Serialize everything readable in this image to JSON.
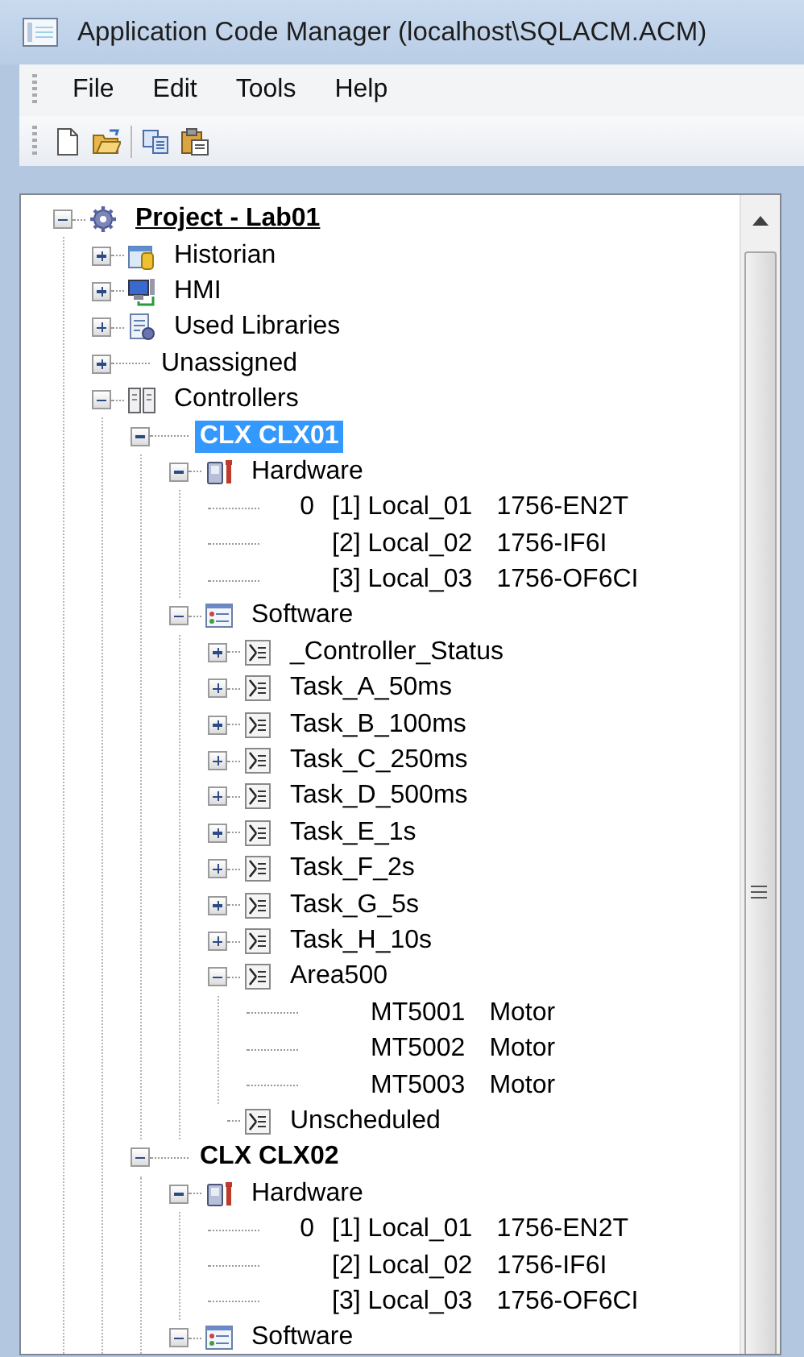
{
  "window": {
    "title": "Application Code Manager (localhost\\SQLACM.ACM)"
  },
  "menu": [
    "File",
    "Edit",
    "Tools",
    "Help"
  ],
  "tree": [
    {
      "label": "Project - Lab01",
      "kind": "project",
      "expanded": true,
      "selected": false,
      "children": [
        {
          "label": "Historian",
          "kind": "historian",
          "expanded": false,
          "selected": false
        },
        {
          "label": "HMI",
          "kind": "hmi",
          "expanded": false,
          "selected": false
        },
        {
          "label": "Used Libraries",
          "kind": "libraries",
          "expanded": false,
          "selected": false
        },
        {
          "label": "Unassigned",
          "kind": "unassigned",
          "expanded": false,
          "selected": false
        },
        {
          "label": "Controllers",
          "kind": "controllers",
          "expanded": true,
          "selected": false,
          "children": [
            {
              "label": "CLX CLX01",
              "kind": "controller",
              "expanded": true,
              "selected": true,
              "children": [
                {
                  "label": "Hardware",
                  "kind": "hardware",
                  "expanded": true,
                  "selected": false,
                  "children": [
                    {
                      "kind": "module",
                      "slot": "0",
                      "name": "[1] Local_01",
                      "type": "1756-EN2T",
                      "selected": false
                    },
                    {
                      "kind": "module",
                      "name": "[2] Local_02",
                      "type": "1756-IF6I",
                      "selected": false
                    },
                    {
                      "kind": "module",
                      "name": "[3] Local_03",
                      "type": "1756-OF6CI",
                      "selected": false
                    }
                  ]
                },
                {
                  "label": "Software",
                  "kind": "software",
                  "expanded": true,
                  "selected": false,
                  "children": [
                    {
                      "label": "_Controller_Status",
                      "kind": "task",
                      "expanded": false,
                      "selected": false
                    },
                    {
                      "label": "Task_A_50ms",
                      "kind": "task",
                      "expanded": false,
                      "selected": false
                    },
                    {
                      "label": "Task_B_100ms",
                      "kind": "task",
                      "expanded": false,
                      "selected": false
                    },
                    {
                      "label": "Task_C_250ms",
                      "kind": "task",
                      "expanded": false,
                      "selected": false
                    },
                    {
                      "label": "Task_D_500ms",
                      "kind": "task",
                      "expanded": false,
                      "selected": false
                    },
                    {
                      "label": "Task_E_1s",
                      "kind": "task",
                      "expanded": false,
                      "selected": false
                    },
                    {
                      "label": "Task_F_2s",
                      "kind": "task",
                      "expanded": false,
                      "selected": false
                    },
                    {
                      "label": "Task_G_5s",
                      "kind": "task",
                      "expanded": false,
                      "selected": false
                    },
                    {
                      "label": "Task_H_10s",
                      "kind": "task",
                      "expanded": false,
                      "selected": false
                    },
                    {
                      "label": "Area500",
                      "kind": "task",
                      "expanded": true,
                      "selected": false,
                      "children": [
                        {
                          "kind": "module",
                          "name": "MT5001",
                          "type": "Motor",
                          "selected": false
                        },
                        {
                          "kind": "module",
                          "name": "MT5002",
                          "type": "Motor",
                          "selected": false
                        },
                        {
                          "kind": "module",
                          "name": "MT5003",
                          "type": "Motor",
                          "selected": false
                        }
                      ]
                    },
                    {
                      "label": "Unscheduled",
                      "kind": "task",
                      "selected": false
                    }
                  ]
                }
              ]
            },
            {
              "label": "CLX CLX02",
              "kind": "controller",
              "expanded": true,
              "selected": false,
              "children": [
                {
                  "label": "Hardware",
                  "kind": "hardware",
                  "expanded": true,
                  "selected": false,
                  "children": [
                    {
                      "kind": "module",
                      "slot": "0",
                      "name": "[1] Local_01",
                      "type": "1756-EN2T",
                      "selected": false
                    },
                    {
                      "kind": "module",
                      "name": "[2] Local_02",
                      "type": "1756-IF6I",
                      "selected": false
                    },
                    {
                      "kind": "module",
                      "name": "[3] Local_03",
                      "type": "1756-OF6CI",
                      "selected": false
                    }
                  ]
                },
                {
                  "label": "Software",
                  "kind": "software",
                  "expanded": true,
                  "selected": false
                }
              ]
            }
          ]
        }
      ]
    }
  ]
}
